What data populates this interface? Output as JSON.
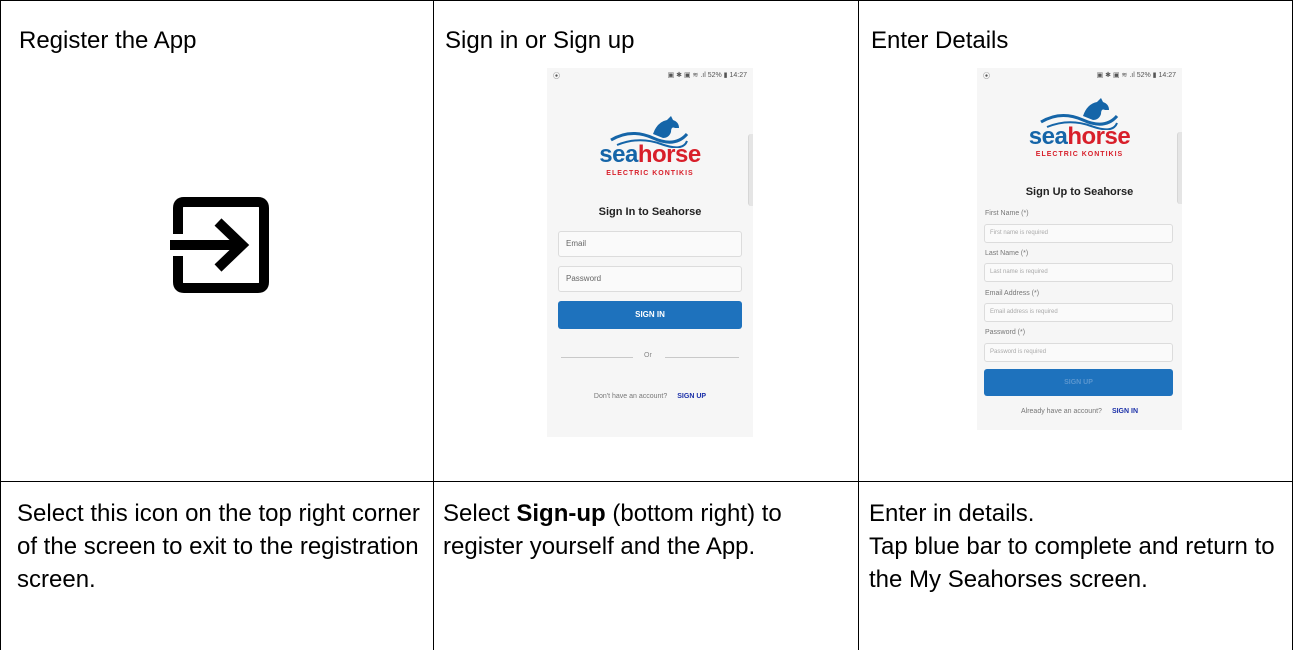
{
  "columns": [
    {
      "title": "Register the App",
      "description": "Select this icon on the top right corner of the screen to exit to the registration screen."
    },
    {
      "title": "Sign in or Sign up",
      "description_before": "Select ",
      "description_bold": "Sign-up",
      "description_after": " (bottom right) to register yourself and the App."
    },
    {
      "title": "Enter Details",
      "description_line1": "Enter in details.",
      "description_line2": "Tap blue bar to complete and return to the My Seahorses screen."
    }
  ],
  "exit_icon": "exit-to-app-icon",
  "brand": {
    "sea": "sea",
    "horse": "horse",
    "tagline": "ELECTRIC KONTIKIS",
    "colors": {
      "blue": "#1565a8",
      "red": "#d81f2a",
      "button": "#1e72bd",
      "link": "#1a2fa8"
    }
  },
  "phone_status": {
    "left": "⦿",
    "right": "▣ ✱ ▣ ≋ .ıl 52% ▮ 14:27"
  },
  "sign_in_screen": {
    "heading": "Sign In to Seahorse",
    "email_placeholder": "Email",
    "password_placeholder": "Password",
    "button": "SIGN IN",
    "or": "Or",
    "footer_text": "Don't have an account?",
    "footer_link": "SIGN UP"
  },
  "sign_up_screen": {
    "heading": "Sign Up to Seahorse",
    "fields": [
      {
        "label": "First Name (*)",
        "placeholder": "First name is required"
      },
      {
        "label": "Last Name (*)",
        "placeholder": "Last name is required"
      },
      {
        "label": "Email Address (*)",
        "placeholder": "Email address is required"
      },
      {
        "label": "Password (*)",
        "placeholder": "Password is required"
      }
    ],
    "button": "SIGN UP",
    "footer_text": "Already have an account?",
    "footer_link": "SIGN IN"
  }
}
